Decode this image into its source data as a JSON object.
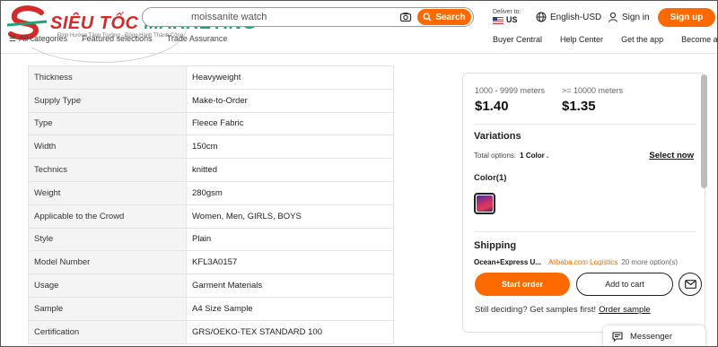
{
  "header": {
    "logo": {
      "brand_red": "SIÊU TỐC",
      "brand_green": "MARKETING",
      "tagline": "Định Hướng Tăng Trưởng - Đồng Hành Thành Công"
    },
    "search": {
      "query": "moissanite watch",
      "button_label": "Search"
    },
    "deliver": {
      "label": "Deliver to:",
      "country": "US"
    },
    "language": "English-USD",
    "signin": "Sign in",
    "signup": "Sign up",
    "nav_left": [
      "All categories",
      "Featured selections",
      "Trade Assurance"
    ],
    "nav_right": [
      "Buyer Central",
      "Help Center",
      "Get the app",
      "Become a supplier"
    ]
  },
  "specs": [
    {
      "key": "Thickness",
      "value": "Heavyweight"
    },
    {
      "key": "Supply Type",
      "value": "Make-to-Order"
    },
    {
      "key": "Type",
      "value": "Fleece Fabric"
    },
    {
      "key": "Width",
      "value": "150cm"
    },
    {
      "key": "Technics",
      "value": "knitted"
    },
    {
      "key": "Weight",
      "value": "280gsm"
    },
    {
      "key": "Applicable to the Crowd",
      "value": "Women, Men, GIRLS, BOYS"
    },
    {
      "key": "Style",
      "value": "Plain"
    },
    {
      "key": "Model Number",
      "value": "KFL3A0157"
    },
    {
      "key": "Usage",
      "value": "Garment Materials"
    },
    {
      "key": "Sample",
      "value": "A4 Size Sample"
    },
    {
      "key": "Certification",
      "value": "GRS/OEKO-TEX STANDARD 100"
    }
  ],
  "panel": {
    "tiers": [
      {
        "qty": "1000 - 9999 meters",
        "price": "$1.40"
      },
      {
        "qty": ">= 10000 meters",
        "price": "$1.35"
      }
    ],
    "variations_title": "Variations",
    "total_options_label": "Total options:",
    "total_options_value": "1 Color .",
    "select_now": "Select now",
    "color_label": "Color(1)",
    "shipping_title": "Shipping",
    "shipping_method": "Ocean+Express U...",
    "shipping_provider": "Alibaba.com Logistics",
    "shipping_more": "20 more option(s)",
    "start_order": "Start order",
    "add_to_cart": "Add to cart",
    "samples_text": "Still deciding? Get samples first!",
    "order_sample": "Order sample"
  },
  "messenger": "Messenger",
  "colors": {
    "accent": "#ff6a00",
    "logo_red": "#d62a2a",
    "logo_green": "#1fa37a"
  }
}
